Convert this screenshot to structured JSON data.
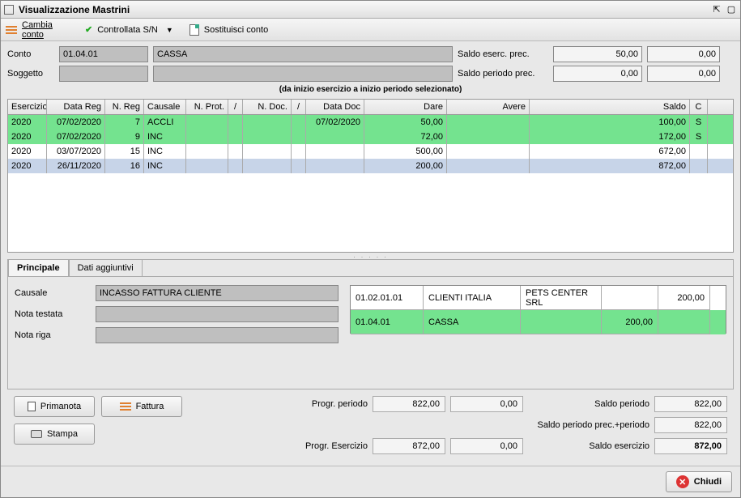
{
  "window": {
    "title": "Visualizzazione Mastrini"
  },
  "toolbar": {
    "cambia_conto": "Cambia conto",
    "controllata": "Controllata S/N",
    "sostituisci": "Sostituisci conto"
  },
  "header": {
    "conto_label": "Conto",
    "conto_code": "01.04.01",
    "conto_name": "CASSA",
    "soggetto_label": "Soggetto",
    "soggetto_code": "",
    "soggetto_name": "",
    "saldo_eserc_prec_label": "Saldo eserc. prec.",
    "saldo_eserc_prec_dare": "50,00",
    "saldo_eserc_prec_avere": "0,00",
    "saldo_periodo_prec_label": "Saldo periodo prec.",
    "saldo_periodo_prec_dare": "0,00",
    "saldo_periodo_prec_avere": "0,00",
    "hint": "(da inizio esercizio a inizio periodo selezionato)"
  },
  "grid": {
    "cols": [
      "Esercizio",
      "Data Reg",
      "N. Reg",
      "Causale",
      "N. Prot.",
      "/",
      "N. Doc.",
      "/",
      "Data Doc",
      "Dare",
      "Avere",
      "Saldo",
      "C"
    ],
    "rows": [
      {
        "cls": "green",
        "c": [
          "2020",
          "07/02/2020",
          "7",
          "ACCLI",
          "",
          "",
          "",
          "",
          "07/02/2020",
          "50,00",
          "",
          "100,00",
          "S"
        ]
      },
      {
        "cls": "green",
        "c": [
          "2020",
          "07/02/2020",
          "9",
          "INC",
          "",
          "",
          "",
          "",
          "",
          "72,00",
          "",
          "172,00",
          "S"
        ]
      },
      {
        "cls": "",
        "c": [
          "2020",
          "03/07/2020",
          "15",
          "INC",
          "",
          "",
          "",
          "",
          "",
          "500,00",
          "",
          "672,00",
          ""
        ]
      },
      {
        "cls": "sel",
        "c": [
          "2020",
          "26/11/2020",
          "16",
          "INC",
          "",
          "",
          "",
          "",
          "",
          "200,00",
          "",
          "872,00",
          ""
        ]
      }
    ]
  },
  "tabs": {
    "principale": "Principale",
    "aggiuntivi": "Dati aggiuntivi"
  },
  "detail": {
    "causale_label": "Causale",
    "causale_value": "INCASSO FATTURA CLIENTE",
    "nota_testata_label": "Nota testata",
    "nota_testata_value": "",
    "nota_riga_label": "Nota riga",
    "nota_riga_value": "",
    "table": [
      {
        "cls": "",
        "c": [
          "01.02.01.01",
          "CLIENTI ITALIA",
          "PETS CENTER SRL",
          "",
          "200,00"
        ]
      },
      {
        "cls": "green",
        "c": [
          "01.04.01",
          "CASSA",
          "",
          "200,00",
          ""
        ]
      }
    ]
  },
  "buttons": {
    "primanota": "Primanota",
    "fattura": "Fattura",
    "stampa": "Stampa"
  },
  "sums": {
    "progr_periodo_label": "Progr. periodo",
    "progr_periodo_dare": "822,00",
    "progr_periodo_avere": "0,00",
    "saldo_periodo_label": "Saldo periodo",
    "saldo_periodo": "822,00",
    "saldo_pp_label": "Saldo periodo prec.+periodo",
    "saldo_pp": "822,00",
    "progr_esercizio_label": "Progr. Esercizio",
    "progr_esercizio_dare": "872,00",
    "progr_esercizio_avere": "0,00",
    "saldo_esercizio_label": "Saldo esercizio",
    "saldo_esercizio": "872,00"
  },
  "footer": {
    "chiudi": "Chiudi"
  }
}
